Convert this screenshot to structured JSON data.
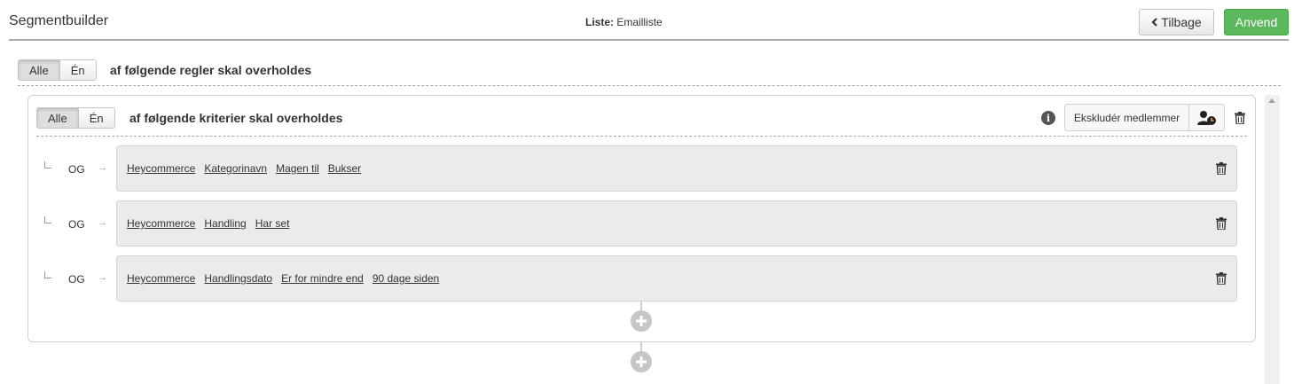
{
  "header": {
    "title": "Segmentbuilder",
    "list_label": "Liste:",
    "list_value": "Emailliste",
    "back_label": "Tilbage",
    "apply_label": "Anvend"
  },
  "outer": {
    "toggle_all": "Alle",
    "toggle_one": "Én",
    "rule_text": "af følgende regler skal overholdes"
  },
  "group": {
    "toggle_all": "Alle",
    "toggle_one": "Én",
    "criteria_text": "af følgende kriterier skal overholdes",
    "exclude_label": "Ekskludér medlemmer",
    "rows": [
      {
        "connector": "OG",
        "chips": [
          "Heycommerce",
          "Kategorinavn",
          "Magen til",
          "Bukser"
        ]
      },
      {
        "connector": "OG",
        "chips": [
          "Heycommerce",
          "Handling",
          "Har set"
        ]
      },
      {
        "connector": "OG",
        "chips": [
          "Heycommerce",
          "Handlingsdato",
          "Er for mindre end",
          "90 dage siden"
        ]
      }
    ]
  },
  "colors": {
    "apply": "#5cb85c",
    "condition_bg": "#ebebeb",
    "plus": "#c6c6c6"
  },
  "icons": [
    "chevron-left-icon",
    "info-icon",
    "person-clock-icon",
    "trash-icon",
    "plus-icon"
  ]
}
